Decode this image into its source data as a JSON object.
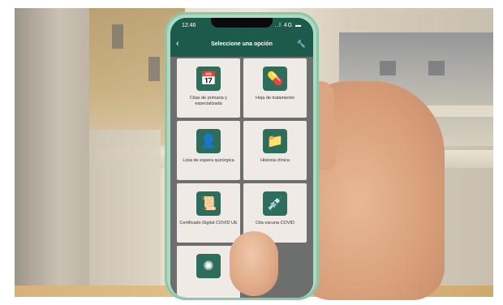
{
  "phone": {
    "status_time": "12:46",
    "status_signal": "..l 4G ▬",
    "title": "Seleccione una opción",
    "back_icon": "chevron-left-icon",
    "tool_icon": "wrench-icon"
  },
  "tiles": [
    {
      "label": "Citas de primaria y especializada",
      "icon": "calendar-clock-icon"
    },
    {
      "label": "Hoja de tratamiento",
      "icon": "pill-icon"
    },
    {
      "label": "Lista de espera quirúrgica",
      "icon": "surgeon-icon"
    },
    {
      "label": "Historia clínica",
      "icon": "folder-icon"
    },
    {
      "label": "Certificado Digital COVID UE",
      "icon": "certificate-icon"
    },
    {
      "label": "Cita vacuna COVID",
      "icon": "syringe-icon"
    },
    {
      "label": "",
      "icon": "virus-icon"
    }
  ]
}
